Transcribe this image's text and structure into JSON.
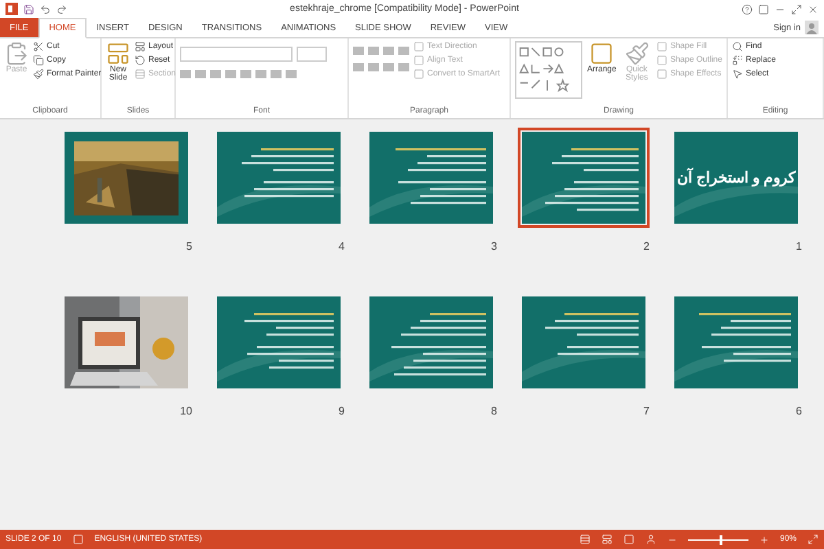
{
  "window": {
    "title": "estekhraje_chrome [Compatibility Mode] - PowerPoint"
  },
  "account": {
    "sign_in": "Sign in"
  },
  "tabs": [
    {
      "label": "FILE",
      "kind": "file",
      "selected": false
    },
    {
      "label": "HOME",
      "kind": "tab",
      "selected": true
    },
    {
      "label": "INSERT",
      "kind": "tab",
      "selected": false
    },
    {
      "label": "DESIGN",
      "kind": "tab",
      "selected": false
    },
    {
      "label": "TRANSITIONS",
      "kind": "tab",
      "selected": false
    },
    {
      "label": "ANIMATIONS",
      "kind": "tab",
      "selected": false
    },
    {
      "label": "SLIDE SHOW",
      "kind": "tab",
      "selected": false
    },
    {
      "label": "REVIEW",
      "kind": "tab",
      "selected": false
    },
    {
      "label": "VIEW",
      "kind": "tab",
      "selected": false
    }
  ],
  "ribbon": [
    {
      "label": "Clipboard",
      "items": [
        {
          "label": "Paste",
          "kind": "large",
          "disabled": true
        },
        {
          "label": "Cut",
          "kind": "small",
          "disabled": false
        },
        {
          "label": "Copy",
          "kind": "small",
          "disabled": false
        },
        {
          "label": "Format Painter",
          "kind": "small",
          "disabled": false
        }
      ]
    },
    {
      "label": "Slides",
      "items": [
        {
          "label": "New Slide",
          "kind": "large",
          "disabled": false
        },
        {
          "label": "Layout",
          "kind": "small",
          "disabled": false
        },
        {
          "label": "Reset",
          "kind": "small",
          "disabled": false
        },
        {
          "label": "Section",
          "kind": "small",
          "disabled": true
        }
      ]
    },
    {
      "label": "Font",
      "items": [
        {
          "kind": "font"
        }
      ]
    },
    {
      "label": "Paragraph",
      "items": [
        {
          "kind": "paragraph"
        },
        {
          "label": "Text Direction",
          "kind": "small",
          "disabled": true
        },
        {
          "label": "Align Text",
          "kind": "small",
          "disabled": true
        },
        {
          "label": "Convert to SmartArt",
          "kind": "small",
          "disabled": true
        }
      ]
    },
    {
      "label": "Drawing",
      "items": [
        {
          "kind": "shapes"
        },
        {
          "label": "Arrange",
          "kind": "large",
          "disabled": false
        },
        {
          "label": "Quick Styles",
          "kind": "large",
          "disabled": true
        },
        {
          "label": "Shape Fill",
          "kind": "small",
          "disabled": true
        },
        {
          "label": "Shape Outline",
          "kind": "small",
          "disabled": true
        },
        {
          "label": "Shape Effects",
          "kind": "small",
          "disabled": true
        }
      ]
    },
    {
      "label": "Editing",
      "items": [
        {
          "label": "Find",
          "kind": "small",
          "disabled": false
        },
        {
          "label": "Replace",
          "kind": "small",
          "disabled": false
        },
        {
          "label": "Select",
          "kind": "small",
          "disabled": false
        }
      ]
    }
  ],
  "slides": [
    {
      "number": "5",
      "kind": "picture",
      "selected": false
    },
    {
      "number": "4",
      "kind": "text",
      "selected": false
    },
    {
      "number": "3",
      "kind": "text",
      "selected": false
    },
    {
      "number": "2",
      "kind": "text",
      "selected": true
    },
    {
      "number": "1",
      "kind": "title",
      "title": "کروم و استخراج آن",
      "selected": false
    },
    {
      "number": "10",
      "kind": "picture",
      "selected": false
    },
    {
      "number": "9",
      "kind": "text",
      "selected": false
    },
    {
      "number": "8",
      "kind": "text",
      "selected": false
    },
    {
      "number": "7",
      "kind": "text",
      "selected": false
    },
    {
      "number": "6",
      "kind": "text",
      "selected": false
    }
  ],
  "status_bar": {
    "slide_info": "SLIDE 2 OF 10",
    "language": "ENGLISH (UNITED STATES)",
    "zoom": {
      "reading": "90%",
      "level": 0.55
    }
  }
}
